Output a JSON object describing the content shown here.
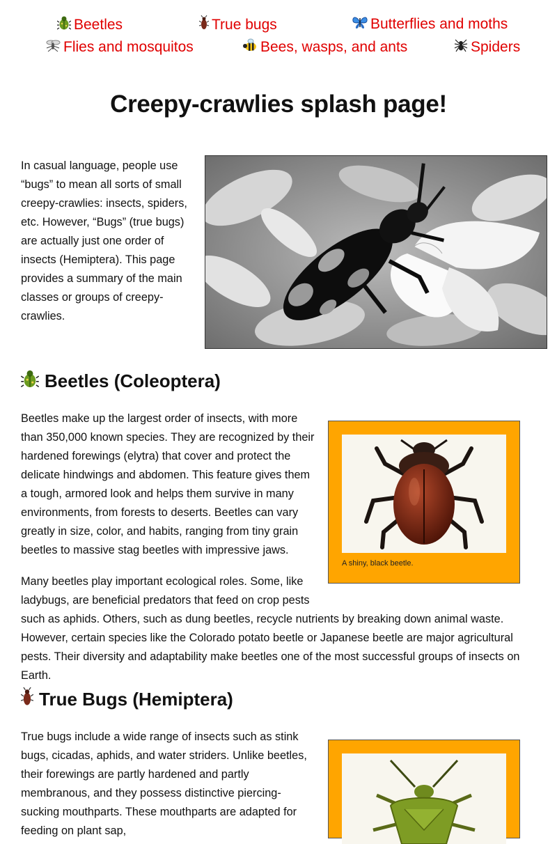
{
  "nav": [
    {
      "icon": "beetle-icon",
      "label": "Beetles"
    },
    {
      "icon": "cockroach-icon",
      "label": "True bugs"
    },
    {
      "icon": "butterfly-icon",
      "label": "Butterflies and moths"
    },
    {
      "icon": "mosquito-icon",
      "label": "Flies and mosquitos"
    },
    {
      "icon": "bee-icon",
      "label": "Bees, wasps, and ants"
    },
    {
      "icon": "spider-icon",
      "label": "Spiders"
    }
  ],
  "page": {
    "title": "Creepy-crawlies splash page!",
    "intro": "In casual language, people use “bugs” to mean all sorts of small creepy-crawlies: insects, spiders, etc. However, “Bugs” (true bugs) are actually just one order of insects (Hemiptera). This page provides a summary of the main classes or groups of creepy-crawlies."
  },
  "beetles": {
    "heading": "Beetles (Coleoptera)",
    "p1": "Beetles make up the largest order of insects, with more than 350,000 known species. They are recognized by their hardened forewings (elytra) that cover and protect the delicate hindwings and abdomen. This feature gives them a tough, armored look and helps them survive in many environments, from forests to deserts. Beetles can vary greatly in size, color, and habits, ranging from tiny grain beetles to massive stag beetles with impressive jaws.",
    "p2a": "Many beetles play important ecological roles. Some, like ladybugs, are beneficial predators that feed on crop pests",
    "p2b": "such as aphids. Others, such as dung beetles, recycle nutrients by breaking down animal waste. However, certain species like the Colorado potato beetle or Japanese beetle are major agricultural pests. Their diversity and adaptability make beetles one of the most successful groups of insects on Earth.",
    "caption": "A shiny, black beetle."
  },
  "truebugs": {
    "heading": "True Bugs (Hemiptera)",
    "p1": "True bugs include a wide range of insects such as stink bugs, cicadas, aphids, and water striders. Unlike beetles, their forewings are partly hardened and partly membranous, and they possess distinctive piercing-sucking mouthparts. These mouthparts are adapted for feeding on plant sap,"
  },
  "colors": {
    "link": "#e00000",
    "figure_bg": "#ffa500"
  }
}
